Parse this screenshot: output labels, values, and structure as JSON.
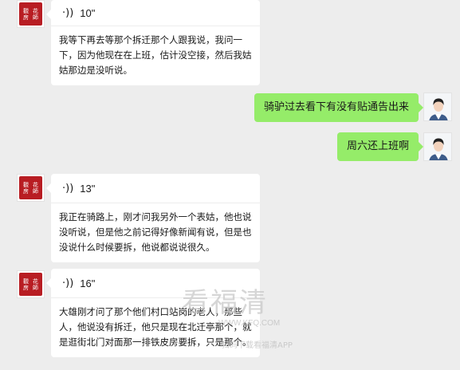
{
  "avatar_seal_chars": [
    "觀",
    "花",
    "房",
    "師"
  ],
  "messages": [
    {
      "side": "left",
      "duration": "10\"",
      "transcript": "我等下再去等那个拆迁那个人跟我说，我问一下，因为他现在在上班，估计没空接，然后我姑姑那边是没听说。"
    },
    {
      "side": "right",
      "text": "骑驴过去看下有没有贴通告出来"
    },
    {
      "side": "right",
      "text": "周六还上班啊"
    },
    {
      "side": "left",
      "duration": "13\"",
      "transcript": "我正在骑路上，刚才问我另外一个表姑，他也说没听说，但是他之前记得好像新闻有说，但是也没说什么时候要拆，他说都说说很久。"
    },
    {
      "side": "left",
      "duration": "16\"",
      "transcript": "大雄刚才问了那个他们村口站岗的老人，那些人，他说没有拆迁，他只是现在北迁亭那个，就是逛街北门对面那一排铁皮房要拆，只是那个。"
    }
  ],
  "watermark": {
    "brand": "看福清",
    "site": "WWW.KFQ.COM",
    "tagline": "扫码下载看福清APP"
  },
  "colors": {
    "background": "#ededed",
    "sent_bubble": "#95ec69",
    "received_bubble": "#ffffff",
    "seal_red": "#b81d23"
  }
}
